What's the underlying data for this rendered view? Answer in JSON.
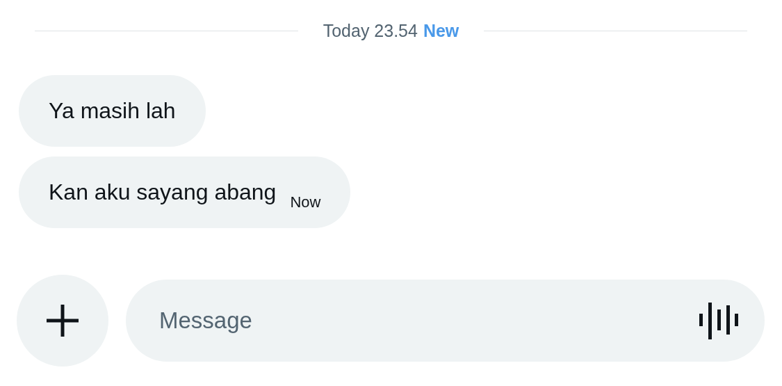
{
  "divider": {
    "date": "Today 23.54",
    "badge": "New"
  },
  "messages": [
    {
      "text": "Ya masih lah"
    },
    {
      "text": "Kan aku sayang abang",
      "time": "Now"
    }
  ],
  "composer": {
    "placeholder": "Message"
  }
}
